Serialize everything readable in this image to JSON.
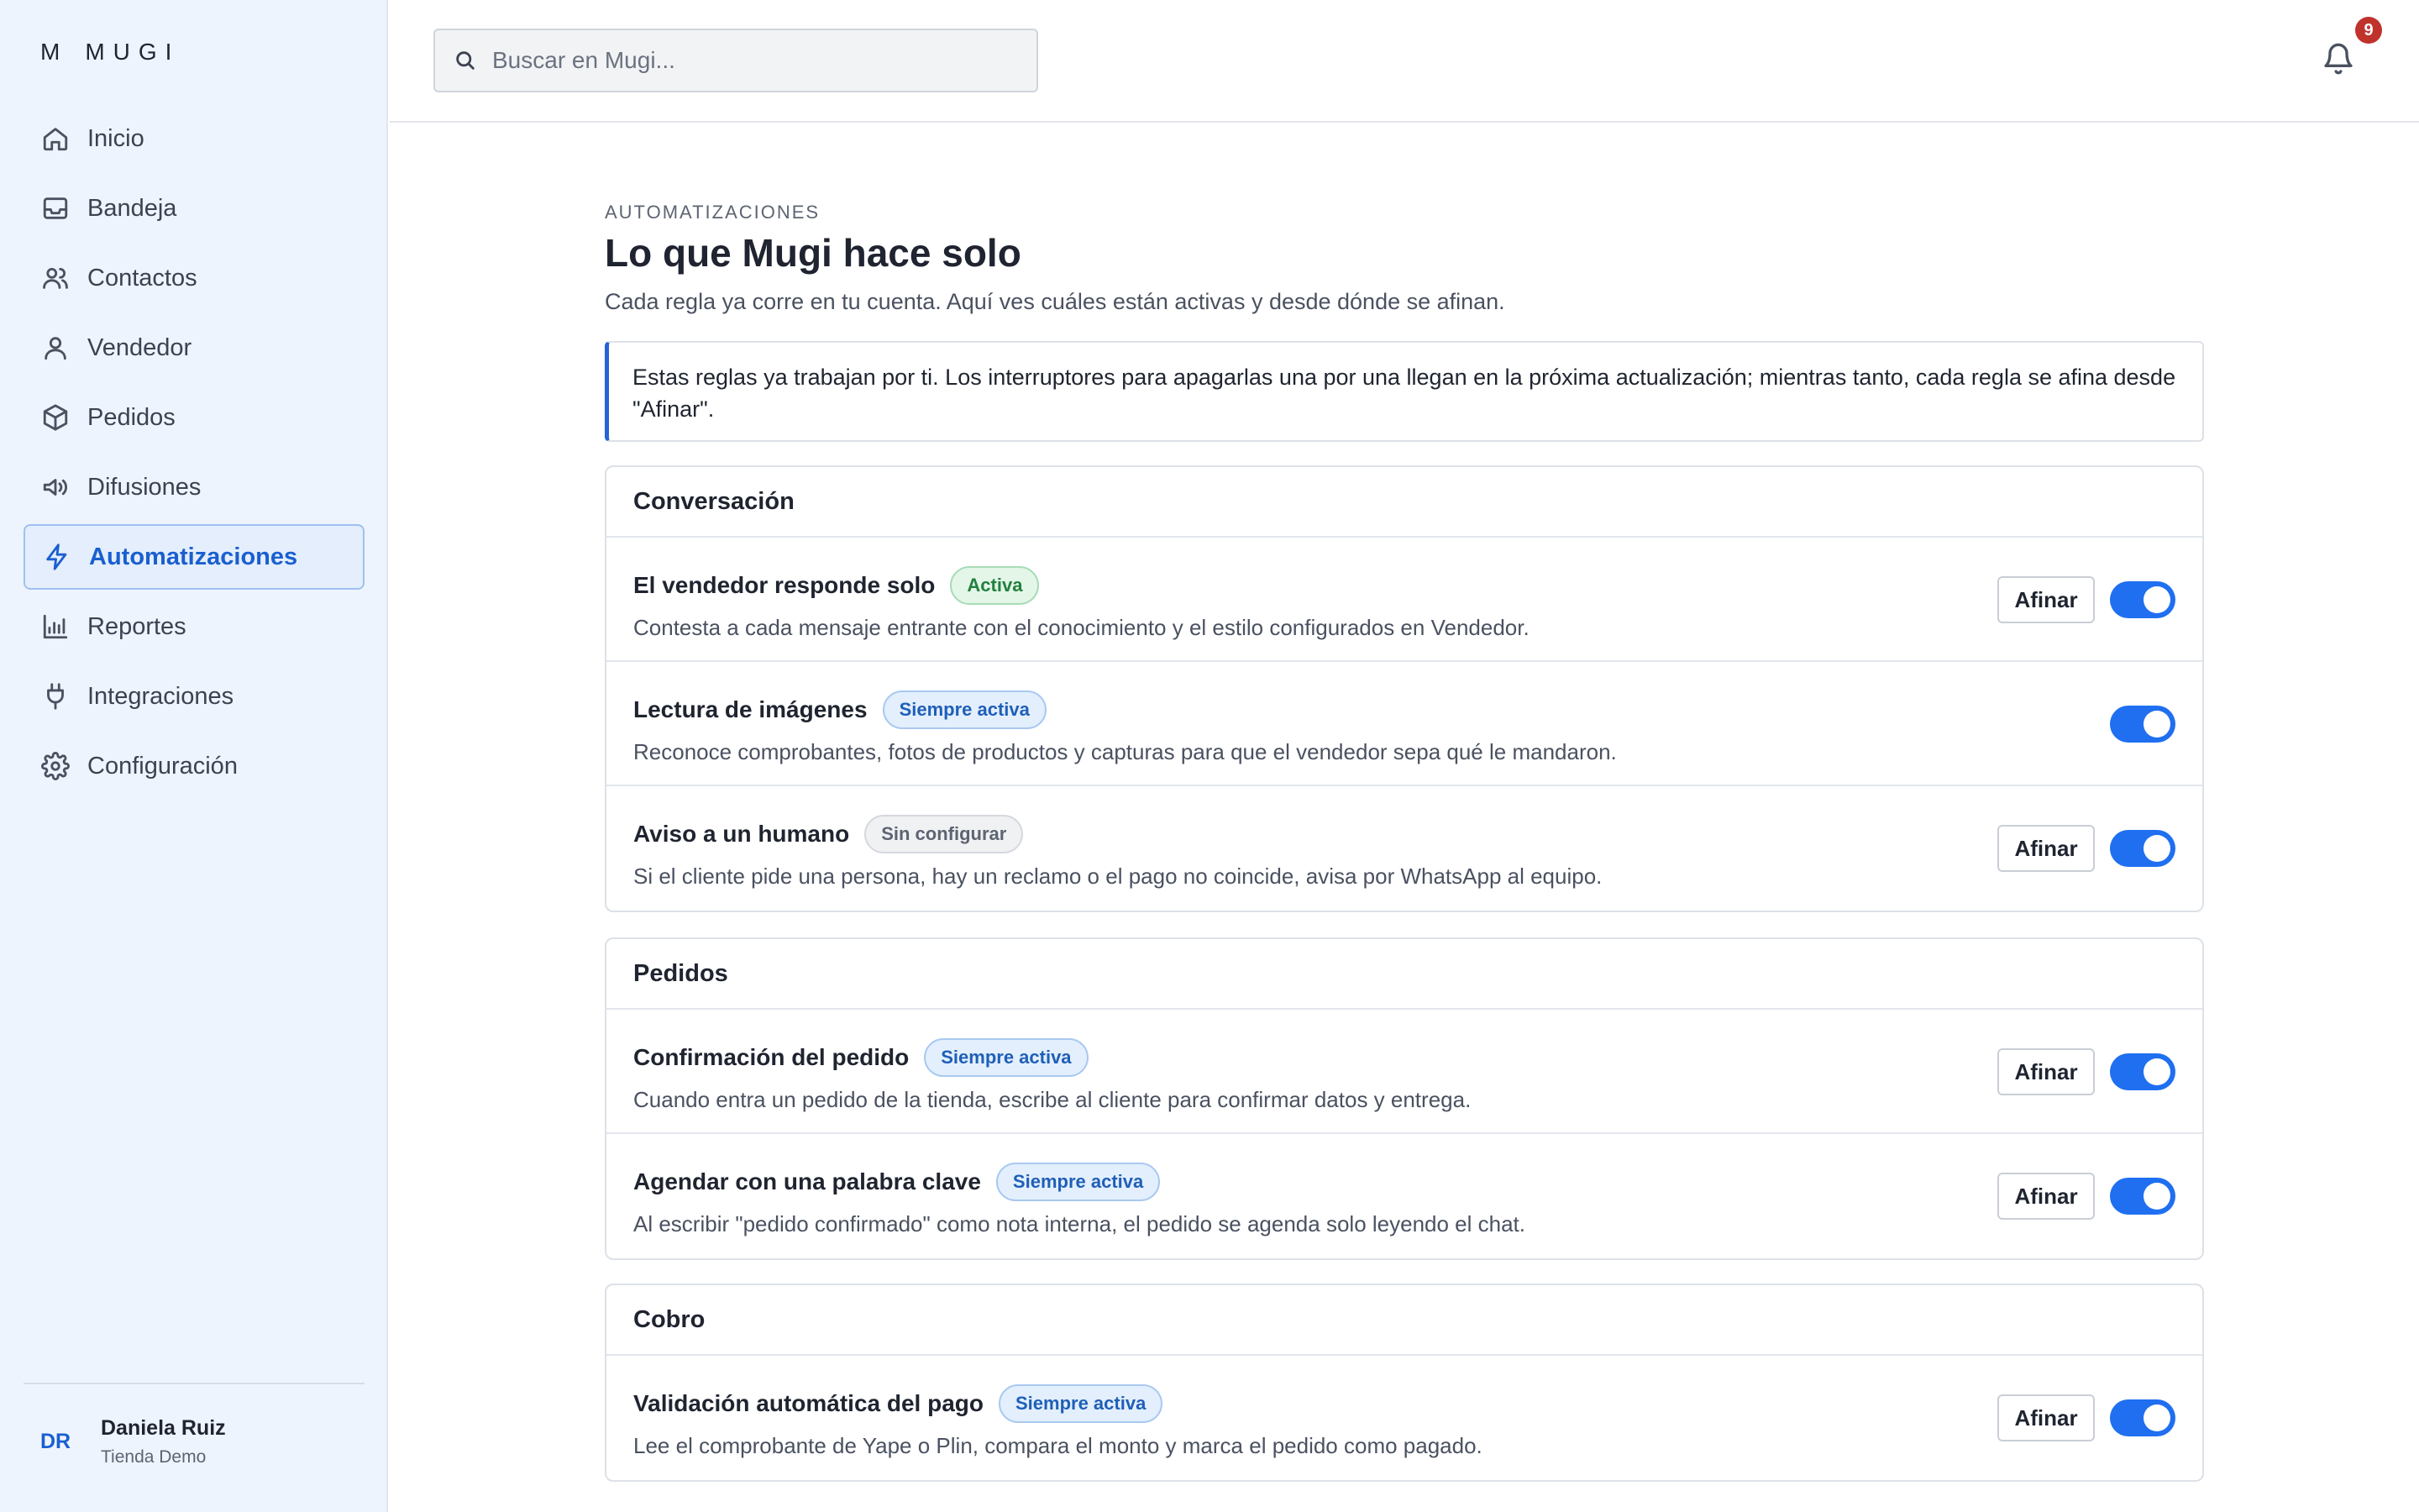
{
  "brand": {
    "mark": "M",
    "name": "MUGI"
  },
  "nav": {
    "items": [
      {
        "label": "Inicio",
        "icon": "home-icon"
      },
      {
        "label": "Bandeja",
        "icon": "inbox-icon"
      },
      {
        "label": "Contactos",
        "icon": "users-icon"
      },
      {
        "label": "Vendedor",
        "icon": "user-icon"
      },
      {
        "label": "Pedidos",
        "icon": "box-icon"
      },
      {
        "label": "Difusiones",
        "icon": "megaphone-icon"
      },
      {
        "label": "Automatizaciones",
        "icon": "lightning-icon",
        "active": true
      },
      {
        "label": "Reportes",
        "icon": "bar-chart-icon"
      },
      {
        "label": "Integraciones",
        "icon": "plug-icon"
      },
      {
        "label": "Configuración",
        "icon": "gear-icon"
      }
    ]
  },
  "user": {
    "initials": "DR",
    "name": "Daniela Ruiz",
    "shop": "Tienda Demo"
  },
  "header": {
    "search_placeholder": "Buscar en Mugi...",
    "notifications_count": "9"
  },
  "page": {
    "eyebrow": "AUTOMATIZACIONES",
    "title": "Lo que Mugi hace solo",
    "subtitle": "Cada regla ya corre en tu cuenta. Aquí ves cuáles están activas y desde dónde se afinan.",
    "notice": "Estas reglas ya trabajan por ti. Los interruptores para apagarlas una por una llegan en la próxima actualización; mientras tanto, cada regla se afina desde \"Afinar\"."
  },
  "sections": [
    {
      "title": "Conversación",
      "rules": [
        {
          "name": "El vendedor responde solo",
          "status": "Activa",
          "status_kind": "green",
          "desc": "Contesta a cada mensaje entrante con el conocimiento y el estilo configurados en Vendedor.",
          "button": "Afinar"
        },
        {
          "name": "Lectura de imágenes",
          "status": "Siempre activa",
          "status_kind": "blue",
          "desc": "Reconoce comprobantes, fotos de productos y capturas para que el vendedor sepa qué le mandaron."
        },
        {
          "name": "Aviso a un humano",
          "status": "Sin configurar",
          "status_kind": "gray",
          "desc": "Si el cliente pide una persona, hay un reclamo o el pago no coincide, avisa por WhatsApp al equipo.",
          "button": "Afinar"
        }
      ]
    },
    {
      "title": "Pedidos",
      "rules": [
        {
          "name": "Confirmación del pedido",
          "status": "Siempre activa",
          "status_kind": "blue",
          "desc": "Cuando entra un pedido de la tienda, escribe al cliente para confirmar datos y entrega.",
          "button": "Afinar"
        },
        {
          "name": "Agendar con una palabra clave",
          "status": "Siempre activa",
          "status_kind": "blue",
          "desc": "Al escribir \"pedido confirmado\" como nota interna, el pedido se agenda solo leyendo el chat.",
          "button": "Afinar"
        }
      ]
    },
    {
      "title": "Cobro",
      "rules": [
        {
          "name": "Validación automática del pago",
          "status": "Siempre activa",
          "status_kind": "blue",
          "desc": "Lee el comprobante de Yape o Plin, compara el monto y marca el pedido como pagado.",
          "button": "Afinar"
        }
      ]
    }
  ],
  "colors": {
    "accent": "#1f6ff0",
    "sidebar_bg": "#eef4fd",
    "badge": "#c0322c"
  }
}
